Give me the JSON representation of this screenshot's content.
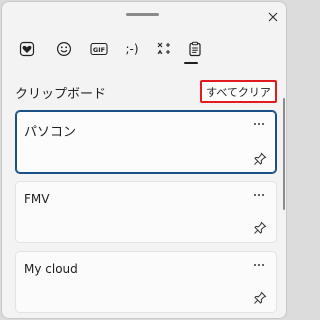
{
  "header": {
    "close_icon": "close-icon"
  },
  "tabs": [
    {
      "name": "emoji-heart",
      "icon": "heart-icon"
    },
    {
      "name": "emoji",
      "icon": "smiley-icon"
    },
    {
      "name": "gif",
      "icon": "gif-icon",
      "label": "GIF"
    },
    {
      "name": "kaomoji",
      "icon": "kaomoji-icon",
      "label": ";-)"
    },
    {
      "name": "symbols",
      "icon": "symbols-icon"
    },
    {
      "name": "clipboard",
      "icon": "clipboard-icon",
      "selected": true
    }
  ],
  "clipboard": {
    "title": "クリップボード",
    "clear_all_label": "すべてクリア",
    "items": [
      {
        "text": "パソコン",
        "selected": true
      },
      {
        "text": "FMV",
        "selected": false
      },
      {
        "text": "My cloud",
        "selected": false
      }
    ]
  },
  "colors": {
    "highlight_border": "#e21c1c",
    "selected_card_border": "#1a4f86"
  }
}
